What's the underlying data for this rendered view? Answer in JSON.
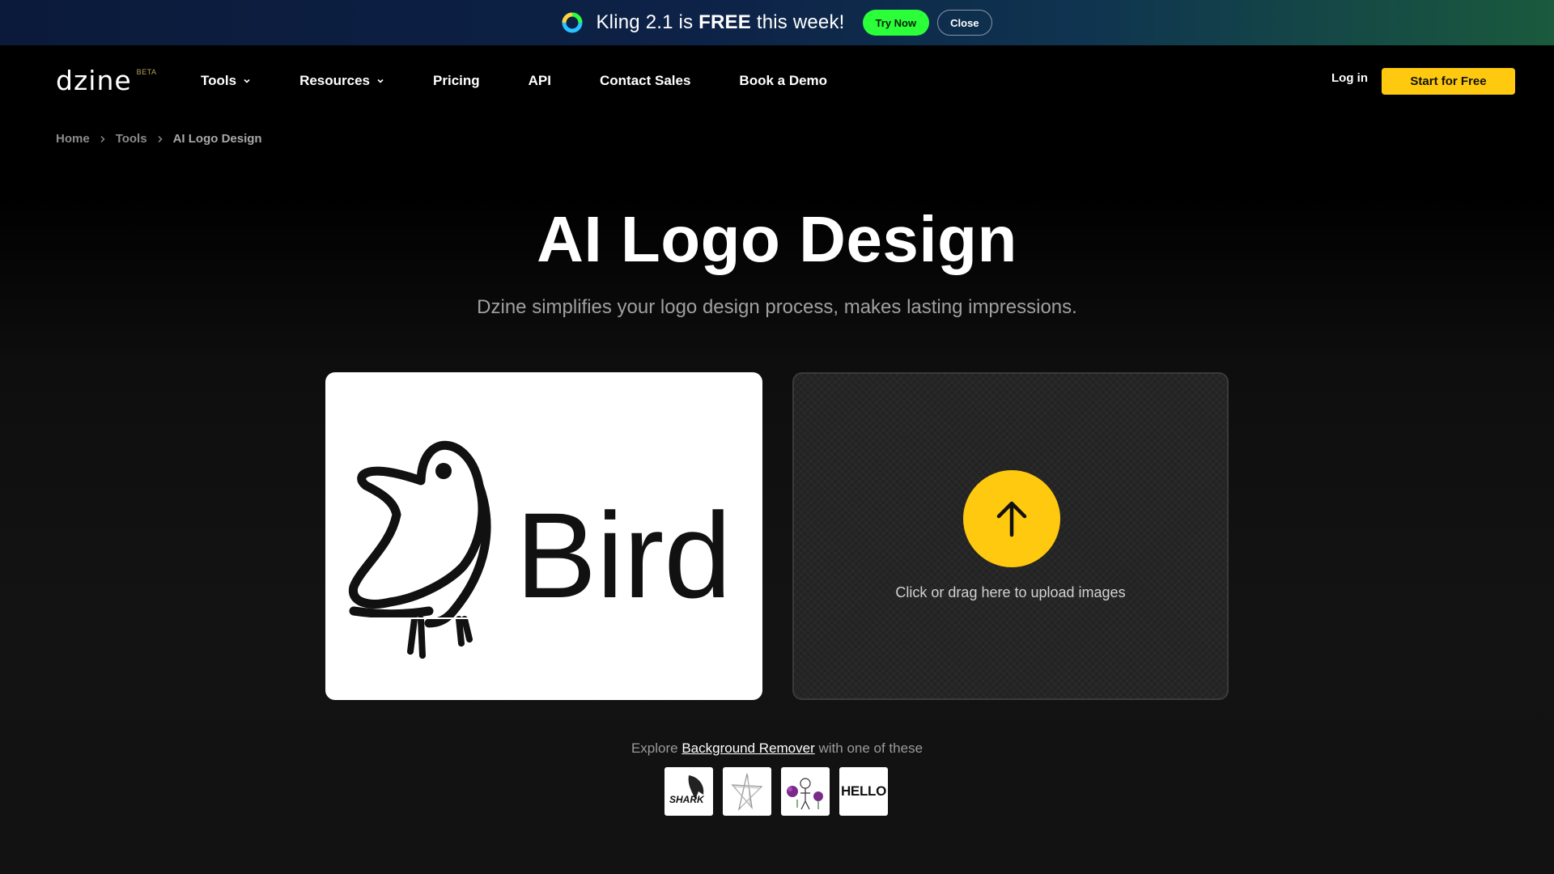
{
  "promo": {
    "text_prefix": "Kling 2.1 is ",
    "text_bold": "FREE",
    "text_suffix": " this week!",
    "try_label": "Try Now",
    "close_label": "Close"
  },
  "brand": {
    "name": "dzine",
    "badge": "BETA"
  },
  "nav": {
    "items": [
      {
        "label": "Tools",
        "has_dropdown": true
      },
      {
        "label": "Resources",
        "has_dropdown": true
      },
      {
        "label": "Pricing"
      },
      {
        "label": "API"
      },
      {
        "label": "Contact Sales"
      },
      {
        "label": "Book a Demo"
      }
    ],
    "login_label": "Log in",
    "start_label": "Start for Free"
  },
  "breadcrumb": [
    "Home",
    "Tools",
    "AI Logo Design"
  ],
  "hero": {
    "title": "AI Logo Design",
    "subtitle": "Dzine simplifies your logo design process, makes lasting impressions."
  },
  "sample": {
    "logo_text": "Bird"
  },
  "upload": {
    "label": "Click or drag here to upload images"
  },
  "explore": {
    "prefix": "Explore ",
    "link": "Background Remover",
    "suffix": " with one of these",
    "thumbs": [
      {
        "label": "SHARK",
        "icon": "shark-logo"
      },
      {
        "label": "",
        "icon": "star-sketch"
      },
      {
        "label": "",
        "icon": "flowers-figure"
      },
      {
        "label": "HELLO",
        "icon": "hello-text"
      }
    ]
  },
  "colors": {
    "accent": "#ffc90f",
    "promo_try": "#2bff3a",
    "background": "#000000"
  }
}
